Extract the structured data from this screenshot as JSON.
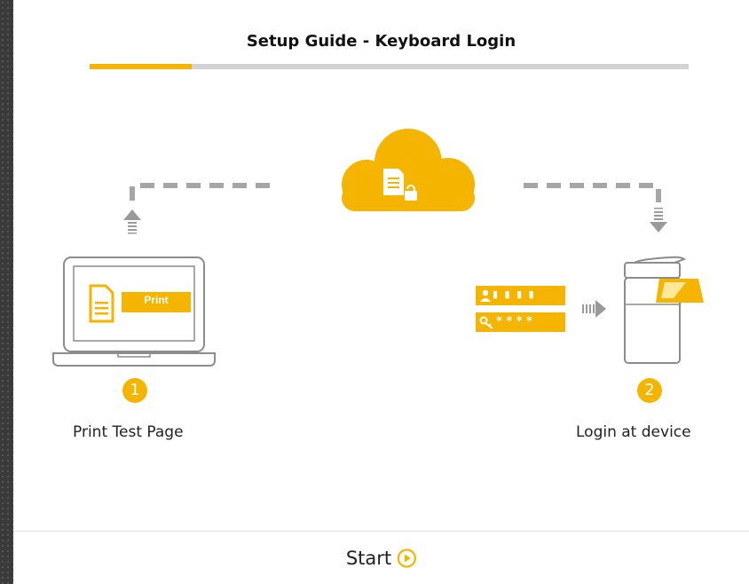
{
  "header": {
    "title": "Setup Guide - Keyboard Login"
  },
  "progress": {
    "fraction": 0.17
  },
  "colors": {
    "accent": "#f5b400",
    "line": "#8c8c8c",
    "dash": "#a6a6a6"
  },
  "steps": [
    {
      "number": "1",
      "label": "Print Test Page",
      "icon": "laptop-icon"
    },
    {
      "number": "2",
      "label": "Login at device",
      "icon": "printer-icon"
    }
  ],
  "laptop": {
    "button_label": "Print"
  },
  "credentials": {
    "username_mask": "▮ ▮ ▮ ▮",
    "password_mask": "* * * *"
  },
  "cloud": {
    "icon": "locked-document-icon"
  },
  "footer": {
    "start_label": "Start",
    "start_icon": "play-circle-icon"
  }
}
